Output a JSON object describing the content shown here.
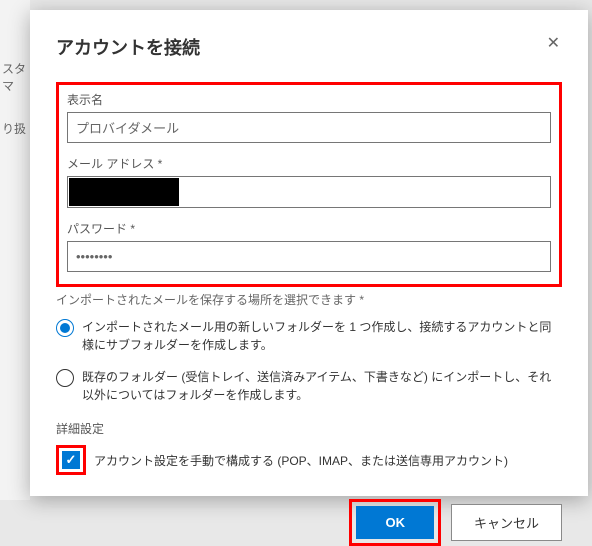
{
  "background": {
    "text1": "スタマ",
    "text2": "り扱"
  },
  "dialog": {
    "title": "アカウントを接続",
    "fields": {
      "display_name": {
        "label": "表示名",
        "value": "プロバイダメール"
      },
      "email": {
        "label": "メール アドレス *"
      },
      "password": {
        "label": "パスワード *",
        "value": "••••••••"
      }
    },
    "import_desc": "インポートされたメールを保存する場所を選択できます *",
    "radio": {
      "opt1": "インポートされたメール用の新しいフォルダーを 1 つ作成し、接続するアカウントと同様にサブフォルダーを作成します。",
      "opt2": "既存のフォルダー (受信トレイ、送信済みアイテム、下書きなど) にインポートし、それ以外についてはフォルダーを作成します。"
    },
    "advanced": {
      "title": "詳細設定",
      "manual": "アカウント設定を手動で構成する (POP、IMAP、または送信専用アカウント)"
    },
    "buttons": {
      "ok": "OK",
      "cancel": "キャンセル"
    }
  }
}
